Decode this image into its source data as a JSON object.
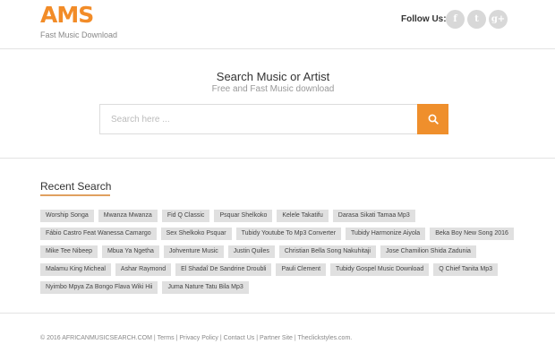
{
  "header": {
    "logo": "AMS",
    "tagline": "Fast Music Download",
    "follow_label": "Follow Us:",
    "social": [
      {
        "glyph": "f",
        "icon": "facebook-icon"
      },
      {
        "glyph": "t",
        "icon": "twitter-icon"
      },
      {
        "glyph": "g+",
        "icon": "google-plus-icon"
      }
    ]
  },
  "hero": {
    "title": "Search Music or Artist",
    "subtitle": "Free and Fast Music download",
    "search_placeholder": "Search here ...",
    "search_value": "",
    "search_button_icon": "search-icon",
    "accent_color": "#ef8f2c"
  },
  "recent": {
    "title": "Recent Search",
    "rows": [
      [
        "Worship Songa",
        "Mwanza Mwanza",
        "Fid Q Classic",
        "Psquar Shelkoko",
        "Kelele Takatifu",
        "Darasa Sikati Tamaa Mp3"
      ],
      [
        "Fábio Castro Feat Wanessa Camargo",
        "Sex Shelkoko Psquar",
        "Tubidy Youtube To Mp3 Converter",
        "Tubidy Harmonize Aiyola",
        "Beka Boy New Song 2016"
      ],
      [
        "Mike Tee Nibeep",
        "Mbua Ya Ngetha",
        "Johventure Music",
        "Justin Quiles",
        "Christian Bella Song Nakuhitaji",
        "Jose Chamilion Shida Zadunia"
      ],
      [
        "Malamu King Micheal",
        "Ashar Raymond",
        "El Shadaî De Sandrine Droubli",
        "Pauli Clement",
        "Tubidy Gospel Music Download",
        "Q Chief Tanita Mp3"
      ],
      [
        "Nyimbo Mpya Za Bongo Flava Wiki Hii",
        "Juma Nature Tatu Bila Mp3"
      ]
    ]
  },
  "footer": {
    "copyright": "© 2016 AFRICANMUSICSEARCH.COM",
    "sep": " | ",
    "links": [
      "Terms",
      "Privacy Policy",
      "Contact Us",
      "Partner Site"
    ],
    "tail": "Theclickstyles.com."
  }
}
